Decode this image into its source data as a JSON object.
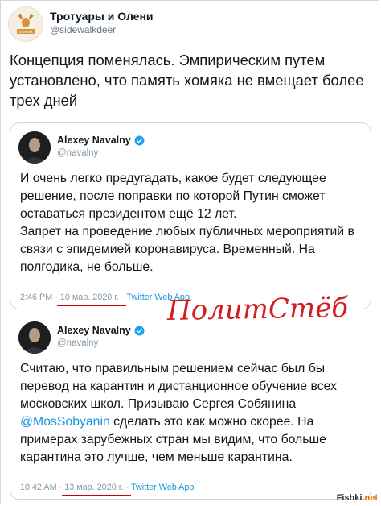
{
  "outer_tweet": {
    "name": "Тротуары и Олени",
    "handle": "@sidewalkdeer",
    "text": "Концепция поменялась. Эмпирическим путем установлено, что память хомяка не вмещает более трех дней",
    "avatar_icon": "deer-logo-icon"
  },
  "quoted_tweets": [
    {
      "name": "Alexey Navalny",
      "handle": "@navalny",
      "verified": true,
      "paragraphs": [
        "И очень легко предугадать, какое будет следующее решение, после поправки по которой Путин сможет оставаться президентом ещё 12 лет.",
        "Запрет на проведение любых публичных мероприятий в связи с эпидемией коронавируса. Временный. На полгодика, не больше."
      ],
      "time": "2:46 PM",
      "date": "10 мар. 2020 г.",
      "source": "Twitter Web App"
    },
    {
      "name": "Alexey Navalny",
      "handle": "@navalny",
      "verified": true,
      "text_before": "Считаю, что правильным решением сейчас был бы перевод на карантин и дистанционное обучение всех московских школ. Призываю Сергея Собянина ",
      "mention": "@MosSobyanin",
      "text_after": " сделать это как можно скорее. На примерах зарубежных стран мы видим, что больше карантина это лучше, чем меньше карантина.",
      "time": "10:42 AM",
      "date": "13 мар. 2020 г.",
      "source": "Twitter Web App"
    }
  ],
  "watermark": "ПолитСтёб",
  "site_watermark": {
    "main": "Fishki",
    "suffix": ".net"
  },
  "colors": {
    "link": "#1b95e0",
    "underline": "#d40000",
    "watermark": "#d21f1f",
    "verified": "#1da1f2"
  }
}
